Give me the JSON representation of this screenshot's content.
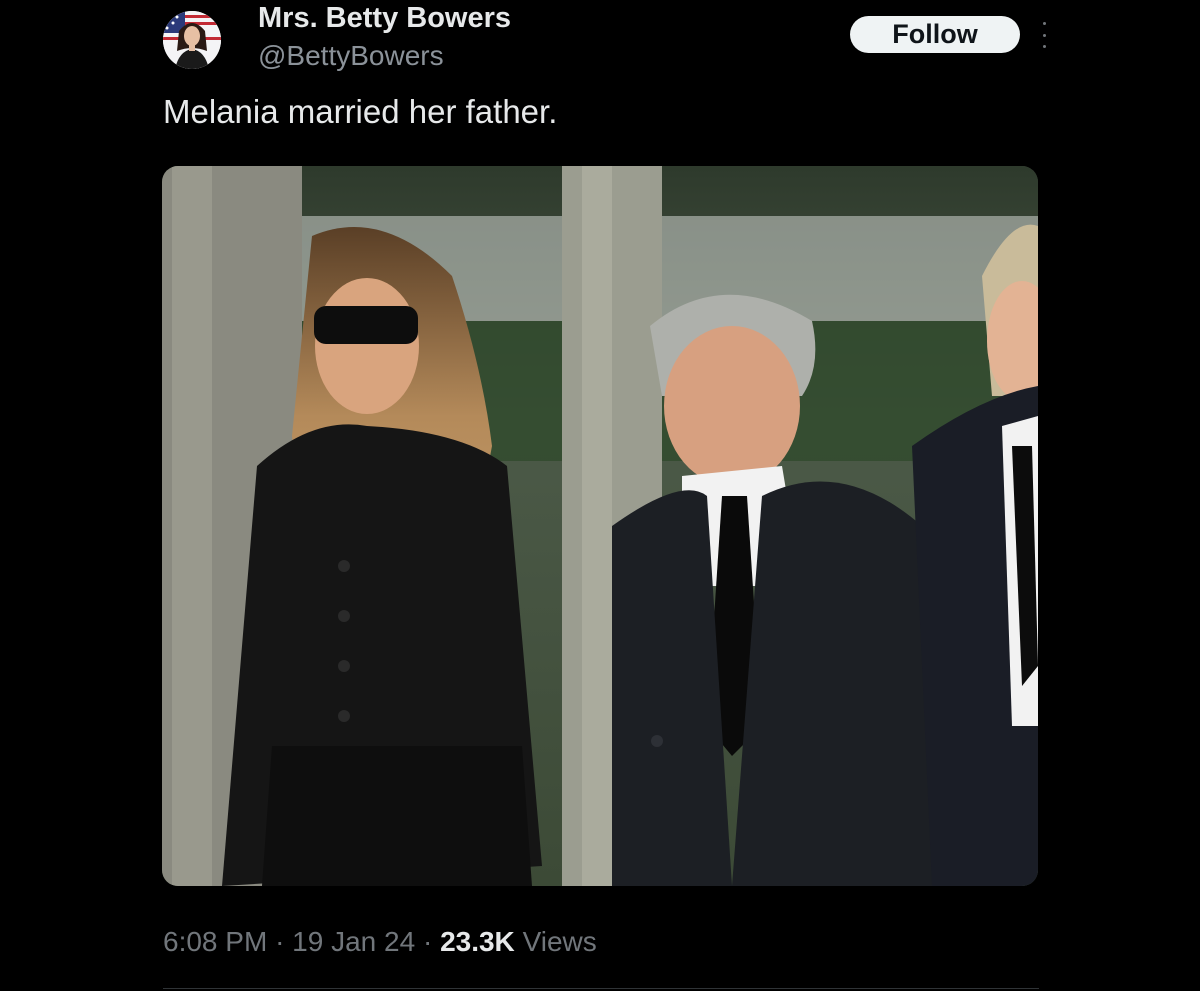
{
  "author": {
    "display_name": "Mrs. Betty Bowers",
    "handle": "@BettyBowers",
    "avatar_icon": "profile-avatar"
  },
  "follow_label": "Follow",
  "more_icon": "more-vertical-icon",
  "tweet_text": "Melania married her father.",
  "media": {
    "icon": "photo-of-three-people-in-black-attire-walking-outdoors"
  },
  "meta": {
    "time": "6:08 PM",
    "separator": "·",
    "date": "19 Jan 24",
    "views_count": "23.3K",
    "views_label": "Views"
  },
  "colors": {
    "background": "#000000",
    "primary_text": "#e7e9ea",
    "secondary_text": "#71767b",
    "follow_button_bg": "#eff3f4",
    "follow_button_text": "#0f1419"
  }
}
